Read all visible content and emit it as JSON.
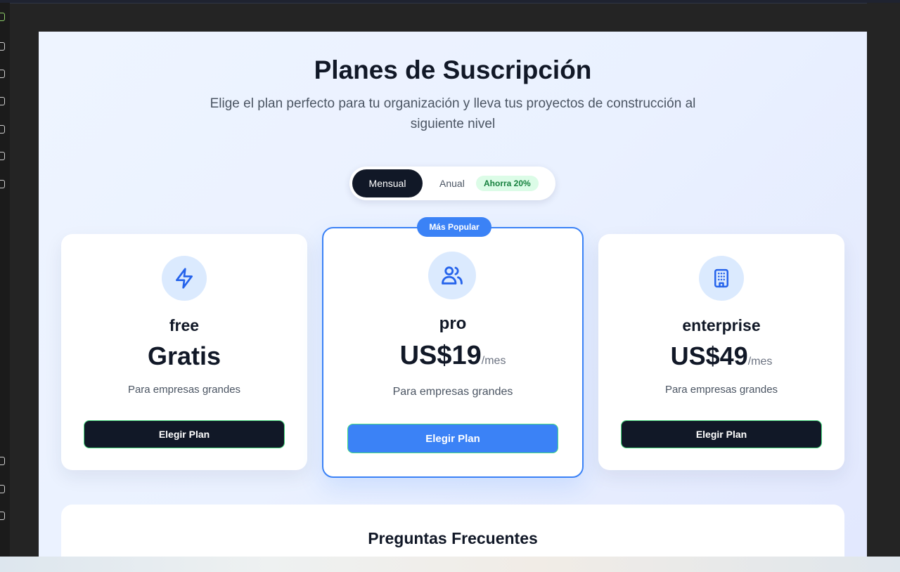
{
  "header": {
    "title": "Planes de Suscripción",
    "subtitle": "Elige el plan perfecto para tu organización y lleva tus proyectos de construcción al siguiente nivel"
  },
  "billing_toggle": {
    "monthly_label": "Mensual",
    "annual_label": "Anual",
    "annual_badge": "Ahorra 20%",
    "selected": "Mensual"
  },
  "plans": [
    {
      "icon": "lightning-icon",
      "name": "free",
      "price": "Gratis",
      "period": "",
      "description": "Para empresas grandes",
      "button_label": "Elegir Plan"
    },
    {
      "icon": "users-icon",
      "name": "pro",
      "price": "US$19",
      "period": "/mes",
      "description": "Para empresas grandes",
      "button_label": "Elegir Plan",
      "badge": "Más Popular"
    },
    {
      "icon": "building-icon",
      "name": "enterprise",
      "price": "US$49",
      "period": "/mes",
      "description": "Para empresas grandes",
      "button_label": "Elegir Plan"
    }
  ],
  "faq": {
    "title": "Preguntas Frecuentes"
  },
  "colors": {
    "primary_dark": "#111827",
    "accent_blue": "#3b82f6",
    "icon_bg": "#dbeafe",
    "save_badge_bg": "#dcfce7",
    "save_badge_text": "#15803d"
  }
}
